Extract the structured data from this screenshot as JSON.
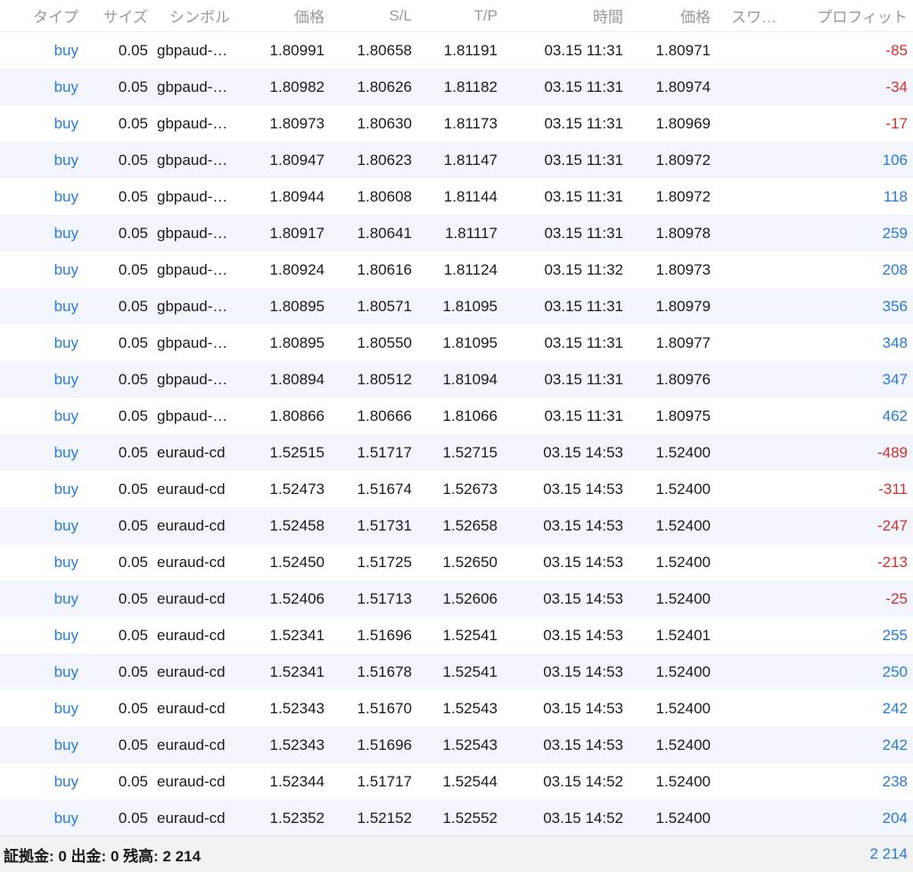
{
  "header": {
    "type": "タイプ",
    "size": "サイズ",
    "symbol": "シンボル",
    "price": "価格",
    "sl": "S/L",
    "tp": "T/P",
    "time": "時間",
    "current_price": "価格",
    "swap": "スワ…",
    "profit": "プロフィット"
  },
  "colors": {
    "accent_blue": "#2a7bd8",
    "loss_red": "#d32f2f",
    "row_alt": "#f2f5fc",
    "footer_bg": "#f1f2f4"
  },
  "rows": [
    {
      "type": "buy",
      "size": "0.05",
      "symbol": "gbpaud-…",
      "price": "1.80991",
      "sl": "1.80658",
      "tp": "1.81191",
      "time": "03.15 11:31",
      "current": "1.80971",
      "swap": "",
      "profit": "-85",
      "profit_sign": "neg"
    },
    {
      "type": "buy",
      "size": "0.05",
      "symbol": "gbpaud-…",
      "price": "1.80982",
      "sl": "1.80626",
      "tp": "1.81182",
      "time": "03.15 11:31",
      "current": "1.80974",
      "swap": "",
      "profit": "-34",
      "profit_sign": "neg"
    },
    {
      "type": "buy",
      "size": "0.05",
      "symbol": "gbpaud-…",
      "price": "1.80973",
      "sl": "1.80630",
      "tp": "1.81173",
      "time": "03.15 11:31",
      "current": "1.80969",
      "swap": "",
      "profit": "-17",
      "profit_sign": "neg"
    },
    {
      "type": "buy",
      "size": "0.05",
      "symbol": "gbpaud-…",
      "price": "1.80947",
      "sl": "1.80623",
      "tp": "1.81147",
      "time": "03.15 11:31",
      "current": "1.80972",
      "swap": "",
      "profit": "106",
      "profit_sign": "pos"
    },
    {
      "type": "buy",
      "size": "0.05",
      "symbol": "gbpaud-…",
      "price": "1.80944",
      "sl": "1.80608",
      "tp": "1.81144",
      "time": "03.15 11:31",
      "current": "1.80972",
      "swap": "",
      "profit": "118",
      "profit_sign": "pos"
    },
    {
      "type": "buy",
      "size": "0.05",
      "symbol": "gbpaud-…",
      "price": "1.80917",
      "sl": "1.80641",
      "tp": "1.81117",
      "time": "03.15 11:31",
      "current": "1.80978",
      "swap": "",
      "profit": "259",
      "profit_sign": "pos"
    },
    {
      "type": "buy",
      "size": "0.05",
      "symbol": "gbpaud-…",
      "price": "1.80924",
      "sl": "1.80616",
      "tp": "1.81124",
      "time": "03.15 11:32",
      "current": "1.80973",
      "swap": "",
      "profit": "208",
      "profit_sign": "pos"
    },
    {
      "type": "buy",
      "size": "0.05",
      "symbol": "gbpaud-…",
      "price": "1.80895",
      "sl": "1.80571",
      "tp": "1.81095",
      "time": "03.15 11:31",
      "current": "1.80979",
      "swap": "",
      "profit": "356",
      "profit_sign": "pos"
    },
    {
      "type": "buy",
      "size": "0.05",
      "symbol": "gbpaud-…",
      "price": "1.80895",
      "sl": "1.80550",
      "tp": "1.81095",
      "time": "03.15 11:31",
      "current": "1.80977",
      "swap": "",
      "profit": "348",
      "profit_sign": "pos"
    },
    {
      "type": "buy",
      "size": "0.05",
      "symbol": "gbpaud-…",
      "price": "1.80894",
      "sl": "1.80512",
      "tp": "1.81094",
      "time": "03.15 11:31",
      "current": "1.80976",
      "swap": "",
      "profit": "347",
      "profit_sign": "pos"
    },
    {
      "type": "buy",
      "size": "0.05",
      "symbol": "gbpaud-…",
      "price": "1.80866",
      "sl": "1.80666",
      "tp": "1.81066",
      "time": "03.15 11:31",
      "current": "1.80975",
      "swap": "",
      "profit": "462",
      "profit_sign": "pos"
    },
    {
      "type": "buy",
      "size": "0.05",
      "symbol": "euraud-cd",
      "price": "1.52515",
      "sl": "1.51717",
      "tp": "1.52715",
      "time": "03.15 14:53",
      "current": "1.52400",
      "swap": "",
      "profit": "-489",
      "profit_sign": "neg"
    },
    {
      "type": "buy",
      "size": "0.05",
      "symbol": "euraud-cd",
      "price": "1.52473",
      "sl": "1.51674",
      "tp": "1.52673",
      "time": "03.15 14:53",
      "current": "1.52400",
      "swap": "",
      "profit": "-311",
      "profit_sign": "neg"
    },
    {
      "type": "buy",
      "size": "0.05",
      "symbol": "euraud-cd",
      "price": "1.52458",
      "sl": "1.51731",
      "tp": "1.52658",
      "time": "03.15 14:53",
      "current": "1.52400",
      "swap": "",
      "profit": "-247",
      "profit_sign": "neg"
    },
    {
      "type": "buy",
      "size": "0.05",
      "symbol": "euraud-cd",
      "price": "1.52450",
      "sl": "1.51725",
      "tp": "1.52650",
      "time": "03.15 14:53",
      "current": "1.52400",
      "swap": "",
      "profit": "-213",
      "profit_sign": "neg"
    },
    {
      "type": "buy",
      "size": "0.05",
      "symbol": "euraud-cd",
      "price": "1.52406",
      "sl": "1.51713",
      "tp": "1.52606",
      "time": "03.15 14:53",
      "current": "1.52400",
      "swap": "",
      "profit": "-25",
      "profit_sign": "neg"
    },
    {
      "type": "buy",
      "size": "0.05",
      "symbol": "euraud-cd",
      "price": "1.52341",
      "sl": "1.51696",
      "tp": "1.52541",
      "time": "03.15 14:53",
      "current": "1.52401",
      "swap": "",
      "profit": "255",
      "profit_sign": "pos"
    },
    {
      "type": "buy",
      "size": "0.05",
      "symbol": "euraud-cd",
      "price": "1.52341",
      "sl": "1.51678",
      "tp": "1.52541",
      "time": "03.15 14:53",
      "current": "1.52400",
      "swap": "",
      "profit": "250",
      "profit_sign": "pos"
    },
    {
      "type": "buy",
      "size": "0.05",
      "symbol": "euraud-cd",
      "price": "1.52343",
      "sl": "1.51670",
      "tp": "1.52543",
      "time": "03.15 14:53",
      "current": "1.52400",
      "swap": "",
      "profit": "242",
      "profit_sign": "pos"
    },
    {
      "type": "buy",
      "size": "0.05",
      "symbol": "euraud-cd",
      "price": "1.52343",
      "sl": "1.51696",
      "tp": "1.52543",
      "time": "03.15 14:53",
      "current": "1.52400",
      "swap": "",
      "profit": "242",
      "profit_sign": "pos"
    },
    {
      "type": "buy",
      "size": "0.05",
      "symbol": "euraud-cd",
      "price": "1.52344",
      "sl": "1.51717",
      "tp": "1.52544",
      "time": "03.15 14:52",
      "current": "1.52400",
      "swap": "",
      "profit": "238",
      "profit_sign": "pos"
    },
    {
      "type": "buy",
      "size": "0.05",
      "symbol": "euraud-cd",
      "price": "1.52352",
      "sl": "1.52152",
      "tp": "1.52552",
      "time": "03.15 14:52",
      "current": "1.52400",
      "swap": "",
      "profit": "204",
      "profit_sign": "pos"
    }
  ],
  "footer": {
    "summary": "証拠金: 0 出金: 0 残高: 2 214",
    "total_profit": "2 214"
  }
}
